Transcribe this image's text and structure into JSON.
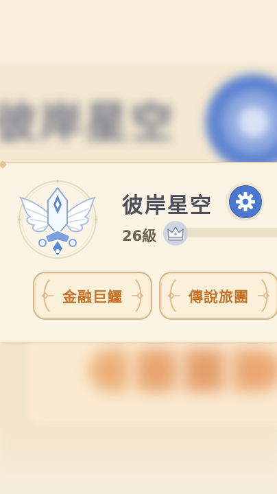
{
  "player": {
    "name": "彼岸星空",
    "level_label": "26級"
  },
  "titles": [
    {
      "label": "金融巨鱷"
    },
    {
      "label": "傳說旅團"
    }
  ],
  "background": {
    "blurred_name": "彼岸星空"
  },
  "icons": {
    "avatar": "winged-star-crest-icon",
    "settings": "gear-icon",
    "level_badge": "crown-icon"
  },
  "colors": {
    "accent_blue": "#4b78cf",
    "title_text": "#c57227",
    "card_bg": "#fbf4e5"
  }
}
